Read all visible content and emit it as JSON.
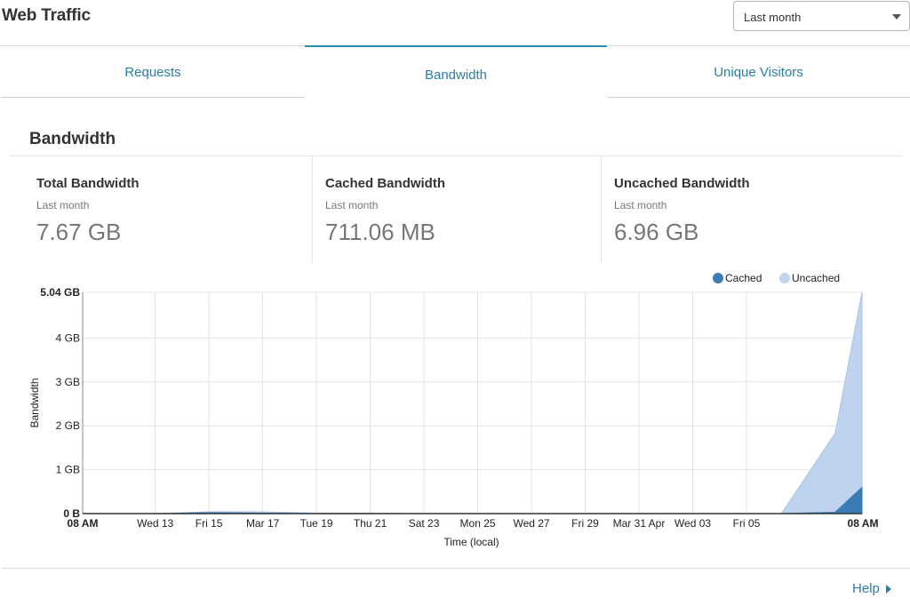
{
  "header": {
    "title": "Web Traffic",
    "range_select": {
      "value": "Last month",
      "icon": "chevron-down-icon"
    }
  },
  "tabs": [
    {
      "label": "Requests",
      "active": false
    },
    {
      "label": "Bandwidth",
      "active": true
    },
    {
      "label": "Unique Visitors",
      "active": false
    }
  ],
  "section": {
    "title": "Bandwidth"
  },
  "stats": [
    {
      "label": "Total Bandwidth",
      "period": "Last month",
      "value": "7.67 GB"
    },
    {
      "label": "Cached Bandwidth",
      "period": "Last month",
      "value": "711.06 MB"
    },
    {
      "label": "Uncached Bandwidth",
      "period": "Last month",
      "value": "6.96 GB"
    }
  ],
  "chart_data": {
    "type": "area",
    "stacked": true,
    "xlabel": "Time (local)",
    "ylabel": "Bandwidth",
    "x_tick_labels": [
      "08 AM",
      "Wed 13",
      "Fri 15",
      "Mar 17",
      "Tue 19",
      "Thu 21",
      "Sat 23",
      "Mon 25",
      "Wed 27",
      "Fri 29",
      "Mar 31 Apr",
      "Wed 03",
      "Fri 05",
      "08 AM"
    ],
    "x_tick_days": [
      0,
      2.7,
      4.7,
      6.7,
      8.7,
      10.7,
      12.7,
      14.7,
      16.7,
      18.7,
      20.7,
      22.7,
      24.7,
      29
    ],
    "y_tick_labels": [
      "0 B",
      "1 GB",
      "2 GB",
      "3 GB",
      "4 GB",
      "5.04 GB"
    ],
    "y_tick_values": [
      0,
      1,
      2,
      3,
      4,
      5.04
    ],
    "ylim": [
      0,
      5.04
    ],
    "xlim_days": [
      0,
      29
    ],
    "grid": true,
    "legend_position": "top-right",
    "series": [
      {
        "name": "Cached",
        "color": "#3a7db5",
        "points_days": [
          0,
          2.7,
          4.7,
          6.7,
          8.7,
          10.7,
          12.7,
          14.7,
          16.7,
          18.7,
          20.7,
          22.7,
          24.7,
          26,
          28,
          29
        ],
        "values_gb": [
          0,
          0,
          0.02,
          0.01,
          0,
          0,
          0,
          0,
          0,
          0,
          0,
          0,
          0,
          0,
          0.03,
          0.6
        ]
      },
      {
        "name": "Uncached",
        "color": "#bfd3ee",
        "points_days": [
          0,
          2.7,
          4.7,
          6.7,
          8.7,
          10.7,
          12.7,
          14.7,
          16.7,
          18.7,
          20.7,
          22.7,
          24.7,
          26,
          28,
          29
        ],
        "values_gb": [
          0,
          0,
          0.02,
          0.03,
          0.01,
          0.01,
          0,
          0,
          0,
          0,
          0,
          0,
          0,
          0,
          1.8,
          4.44
        ]
      }
    ]
  },
  "footer": {
    "help_label": "Help",
    "help_icon": "chevron-right-icon"
  }
}
